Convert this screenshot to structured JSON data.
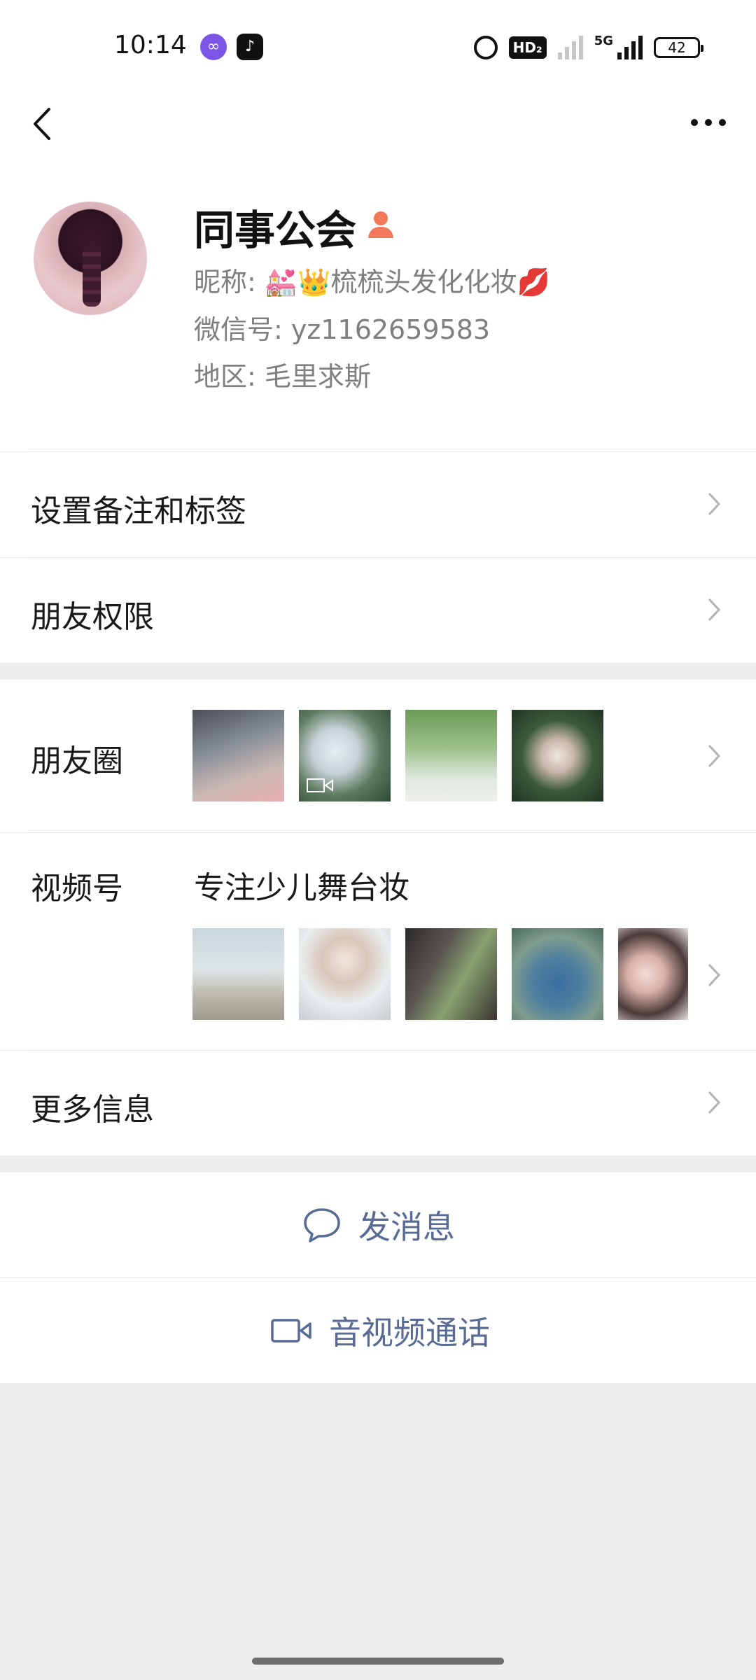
{
  "status_bar": {
    "time": "10:14",
    "app_icons": [
      "infinity-app-icon",
      "tiktok-icon"
    ],
    "hd_label": "HD₂",
    "network_label": "5G",
    "battery": "42"
  },
  "profile": {
    "name": "同事公会",
    "nickname_label": "昵称:",
    "nickname_value": "💒👑梳梳头发化化妆💋",
    "wechat_id_label": "微信号:",
    "wechat_id_value": "yz1162659583",
    "region_label": "地区:",
    "region_value": "毛里求斯"
  },
  "menu": {
    "remarks": "设置备注和标签",
    "permissions": "朋友权限",
    "moments": "朋友圈",
    "channels": "视频号",
    "channels_title": "专注少儿舞台妆",
    "more_info": "更多信息"
  },
  "actions": {
    "send_message": "发消息",
    "av_call": "音视频通话"
  },
  "colors": {
    "link_blue": "#576b95",
    "gender_icon": "#f0795a",
    "background": "#ededed"
  }
}
